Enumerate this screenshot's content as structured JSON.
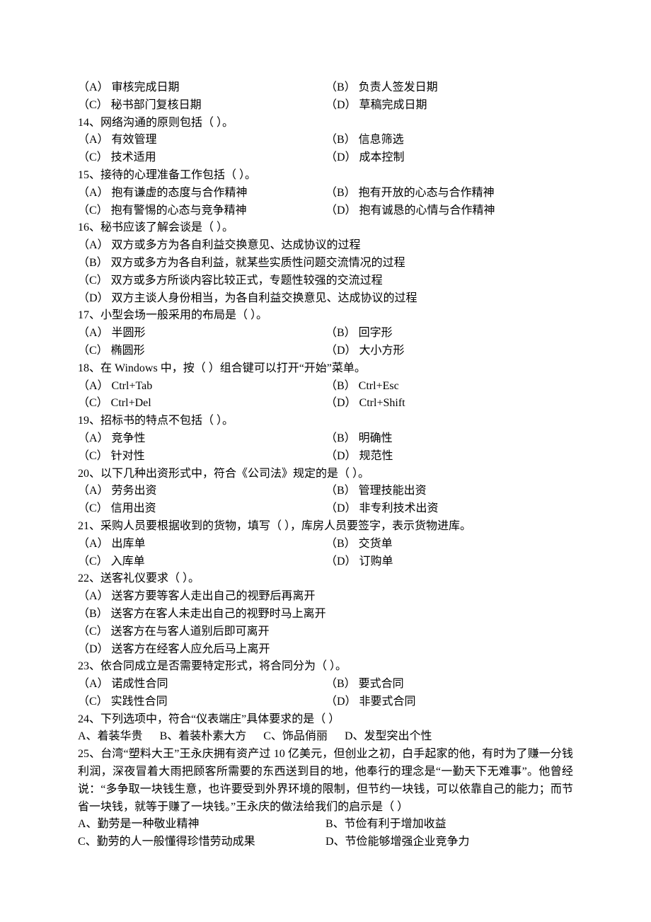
{
  "q13": {
    "a": "（A）  审核完成日期",
    "b": "（B）  负责人签发日期",
    "c": "（C）  秘书部门复核日期",
    "d": "（D）  草稿完成日期"
  },
  "q14": {
    "stem": "14、网络沟通的原则包括（      ）。",
    "a": "（A）  有效管理",
    "b": "（B）  信息筛选",
    "c": "（C）  技术适用",
    "d": "（D）  成本控制"
  },
  "q15": {
    "stem": "15、接待的心理准备工作包括（      ）。",
    "a": "（A）  抱有谦虚的态度与合作精神",
    "b": "（B）  抱有开放的心态与合作精神",
    "c": "（C）  抱有警惕的心态与竞争精神",
    "d": "（D）  抱有诚恳的心情与合作精神"
  },
  "q16": {
    "stem": "16、秘书应该了解会谈是（      ）。",
    "a": "（A）  双方或多方为各自利益交换意见、达成协议的过程",
    "b": "（B）  双方或多方为各自利益，就某些实质性问题交流情况的过程",
    "c": "（C）  双方或多方所谈内容比较正式，专题性较强的交流过程",
    "d": "（D）  双方主谈人身份相当，为各自利益交换意见、达成协议的过程"
  },
  "q17": {
    "stem": "17、小型会场一般采用的布局是（      ）。",
    "a": "（A）  半圆形",
    "b": "（B）  回字形",
    "c": "（C）  椭圆形",
    "d": "（D）  大小方形"
  },
  "q18": {
    "stem": "18、在 Windows 中，按（      ）组合键可以打开“开始”菜单。",
    "a": "（A）  Ctrl+Tab",
    "b": "（B）  Ctrl+Esc",
    "c": "（C）  Ctrl+Del",
    "d": "（D）  Ctrl+Shift"
  },
  "q19": {
    "stem": "19、招标书的特点不包括（      ）。",
    "a": "（A）  竞争性",
    "b": "（B）  明确性",
    "c": "（C）  针对性",
    "d": "（D）  规范性"
  },
  "q20": {
    "stem": "20、以下几种出资形式中，符合《公司法》规定的是（      ）。",
    "a": "（A）  劳务出资",
    "b": "（B）  管理技能出资",
    "c": "（C）  信用出资",
    "d": "（D）  非专利技术出资"
  },
  "q21": {
    "stem": "21、采购人员要根据收到的货物，填写（      ），库房人员要签字，表示货物进库。",
    "a": "（A）  出库单",
    "b": "（B）  交货单",
    "c": "（C）  入库单",
    "d": "（D）  订购单"
  },
  "q22": {
    "stem": "22、送客礼仪要求（      ）。",
    "a": "（A）  送客方要等客人走出自己的视野后再离开",
    "b": "（B）  送客方在客人未走出自己的视野时马上离开",
    "c": "（C）  送客方在与客人道别后即可离开",
    "d": "（D）  送客方在经客人应允后马上离开"
  },
  "q23": {
    "stem": "23、依合同成立是否需要特定形式，将合同分为（      ）。",
    "a": "（A）  诺成性合同",
    "b": "（B）  要式合同",
    "c": "（C）  实践性合同",
    "d": "（D）  非要式合同"
  },
  "q24": {
    "stem": "24、下列选项中，符合“仪表端庄”具体要求的是（ ）",
    "a": "A、着装华贵",
    "b": "B、着装朴素大方",
    "c": "C、饰品俏丽",
    "d": "D、发型突出个性"
  },
  "q25": {
    "stem": "25、台湾“塑料大王”王永庆拥有资产过 10 亿美元，但创业之初，白手起家的他，有时为了赚一分钱利润，深夜冒着大雨把顾客所需要的东西送到目的地，他奉行的理念是“一勤天下无难事”。他曾经说：“多争取一块钱生意，也许要受到外界环境的限制，但节约一块钱，可以依靠自己的能力；而节省一块钱，就等于赚了一块钱。”王永庆的做法给我们的启示是（ ）",
    "a": "A、勤劳是一种敬业精神",
    "b": "B、节俭有利于增加收益",
    "c": "C、勤劳的人一般懂得珍惜劳动成果",
    "d": "D、节俭能够增强企业竞争力"
  }
}
